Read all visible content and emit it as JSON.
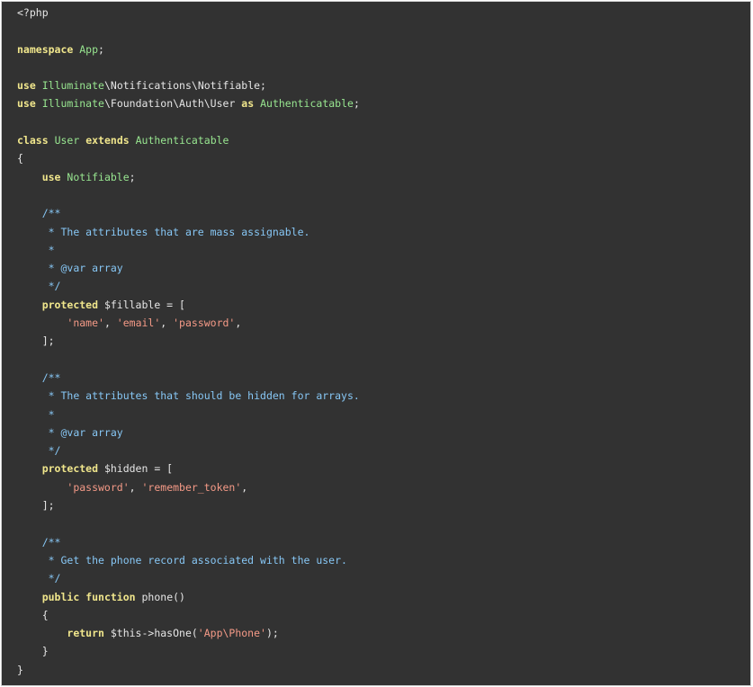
{
  "lines": [
    [
      {
        "t": "plain",
        "v": "<?php"
      }
    ],
    [],
    [
      {
        "t": "kw",
        "v": "namespace"
      },
      {
        "t": "plain",
        "v": " "
      },
      {
        "t": "cls",
        "v": "App"
      },
      {
        "t": "plain",
        "v": ";"
      }
    ],
    [],
    [
      {
        "t": "kw",
        "v": "use"
      },
      {
        "t": "plain",
        "v": " "
      },
      {
        "t": "cls",
        "v": "Illuminate"
      },
      {
        "t": "plain",
        "v": "\\Notifications\\Notifiable;"
      }
    ],
    [
      {
        "t": "kw",
        "v": "use"
      },
      {
        "t": "plain",
        "v": " "
      },
      {
        "t": "cls",
        "v": "Illuminate"
      },
      {
        "t": "plain",
        "v": "\\Foundation\\Auth\\User "
      },
      {
        "t": "kw",
        "v": "as"
      },
      {
        "t": "plain",
        "v": " "
      },
      {
        "t": "cls",
        "v": "Authenticatable"
      },
      {
        "t": "plain",
        "v": ";"
      }
    ],
    [],
    [
      {
        "t": "kw",
        "v": "class"
      },
      {
        "t": "plain",
        "v": " "
      },
      {
        "t": "cls",
        "v": "User"
      },
      {
        "t": "plain",
        "v": " "
      },
      {
        "t": "kw",
        "v": "extends"
      },
      {
        "t": "plain",
        "v": " "
      },
      {
        "t": "cls",
        "v": "Authenticatable"
      }
    ],
    [
      {
        "t": "plain",
        "v": "{"
      }
    ],
    [
      {
        "t": "plain",
        "v": "    "
      },
      {
        "t": "kw",
        "v": "use"
      },
      {
        "t": "plain",
        "v": " "
      },
      {
        "t": "cls",
        "v": "Notifiable"
      },
      {
        "t": "plain",
        "v": ";"
      }
    ],
    [],
    [
      {
        "t": "plain",
        "v": "    "
      },
      {
        "t": "cm",
        "v": "/**"
      }
    ],
    [
      {
        "t": "plain",
        "v": "     "
      },
      {
        "t": "cm",
        "v": "* The attributes that are mass assignable."
      }
    ],
    [
      {
        "t": "plain",
        "v": "     "
      },
      {
        "t": "cm",
        "v": "*"
      }
    ],
    [
      {
        "t": "plain",
        "v": "     "
      },
      {
        "t": "cm",
        "v": "* @var array"
      }
    ],
    [
      {
        "t": "plain",
        "v": "     "
      },
      {
        "t": "cm",
        "v": "*/"
      }
    ],
    [
      {
        "t": "plain",
        "v": "    "
      },
      {
        "t": "kw",
        "v": "protected"
      },
      {
        "t": "plain",
        "v": " $fillable = ["
      }
    ],
    [
      {
        "t": "plain",
        "v": "        "
      },
      {
        "t": "str",
        "v": "'name'"
      },
      {
        "t": "plain",
        "v": ", "
      },
      {
        "t": "str",
        "v": "'email'"
      },
      {
        "t": "plain",
        "v": ", "
      },
      {
        "t": "str",
        "v": "'password'"
      },
      {
        "t": "plain",
        "v": ","
      }
    ],
    [
      {
        "t": "plain",
        "v": "    ];"
      }
    ],
    [],
    [
      {
        "t": "plain",
        "v": "    "
      },
      {
        "t": "cm",
        "v": "/**"
      }
    ],
    [
      {
        "t": "plain",
        "v": "     "
      },
      {
        "t": "cm",
        "v": "* The attributes that should be hidden for arrays."
      }
    ],
    [
      {
        "t": "plain",
        "v": "     "
      },
      {
        "t": "cm",
        "v": "*"
      }
    ],
    [
      {
        "t": "plain",
        "v": "     "
      },
      {
        "t": "cm",
        "v": "* @var array"
      }
    ],
    [
      {
        "t": "plain",
        "v": "     "
      },
      {
        "t": "cm",
        "v": "*/"
      }
    ],
    [
      {
        "t": "plain",
        "v": "    "
      },
      {
        "t": "kw",
        "v": "protected"
      },
      {
        "t": "plain",
        "v": " $hidden = ["
      }
    ],
    [
      {
        "t": "plain",
        "v": "        "
      },
      {
        "t": "str",
        "v": "'password'"
      },
      {
        "t": "plain",
        "v": ", "
      },
      {
        "t": "str",
        "v": "'remember_token'"
      },
      {
        "t": "plain",
        "v": ","
      }
    ],
    [
      {
        "t": "plain",
        "v": "    ];"
      }
    ],
    [],
    [
      {
        "t": "plain",
        "v": "    "
      },
      {
        "t": "cm",
        "v": "/**"
      }
    ],
    [
      {
        "t": "plain",
        "v": "     "
      },
      {
        "t": "cm",
        "v": "* Get the phone record associated with the user."
      }
    ],
    [
      {
        "t": "plain",
        "v": "     "
      },
      {
        "t": "cm",
        "v": "*/"
      }
    ],
    [
      {
        "t": "plain",
        "v": "    "
      },
      {
        "t": "kw",
        "v": "public"
      },
      {
        "t": "plain",
        "v": " "
      },
      {
        "t": "kw",
        "v": "function"
      },
      {
        "t": "plain",
        "v": " phone()"
      }
    ],
    [
      {
        "t": "plain",
        "v": "    {"
      }
    ],
    [
      {
        "t": "plain",
        "v": "        "
      },
      {
        "t": "kw",
        "v": "return"
      },
      {
        "t": "plain",
        "v": " $this->hasOne("
      },
      {
        "t": "str",
        "v": "'App\\Phone'"
      },
      {
        "t": "plain",
        "v": ");"
      }
    ],
    [
      {
        "t": "plain",
        "v": "    }"
      }
    ],
    [
      {
        "t": "plain",
        "v": "}"
      }
    ]
  ]
}
